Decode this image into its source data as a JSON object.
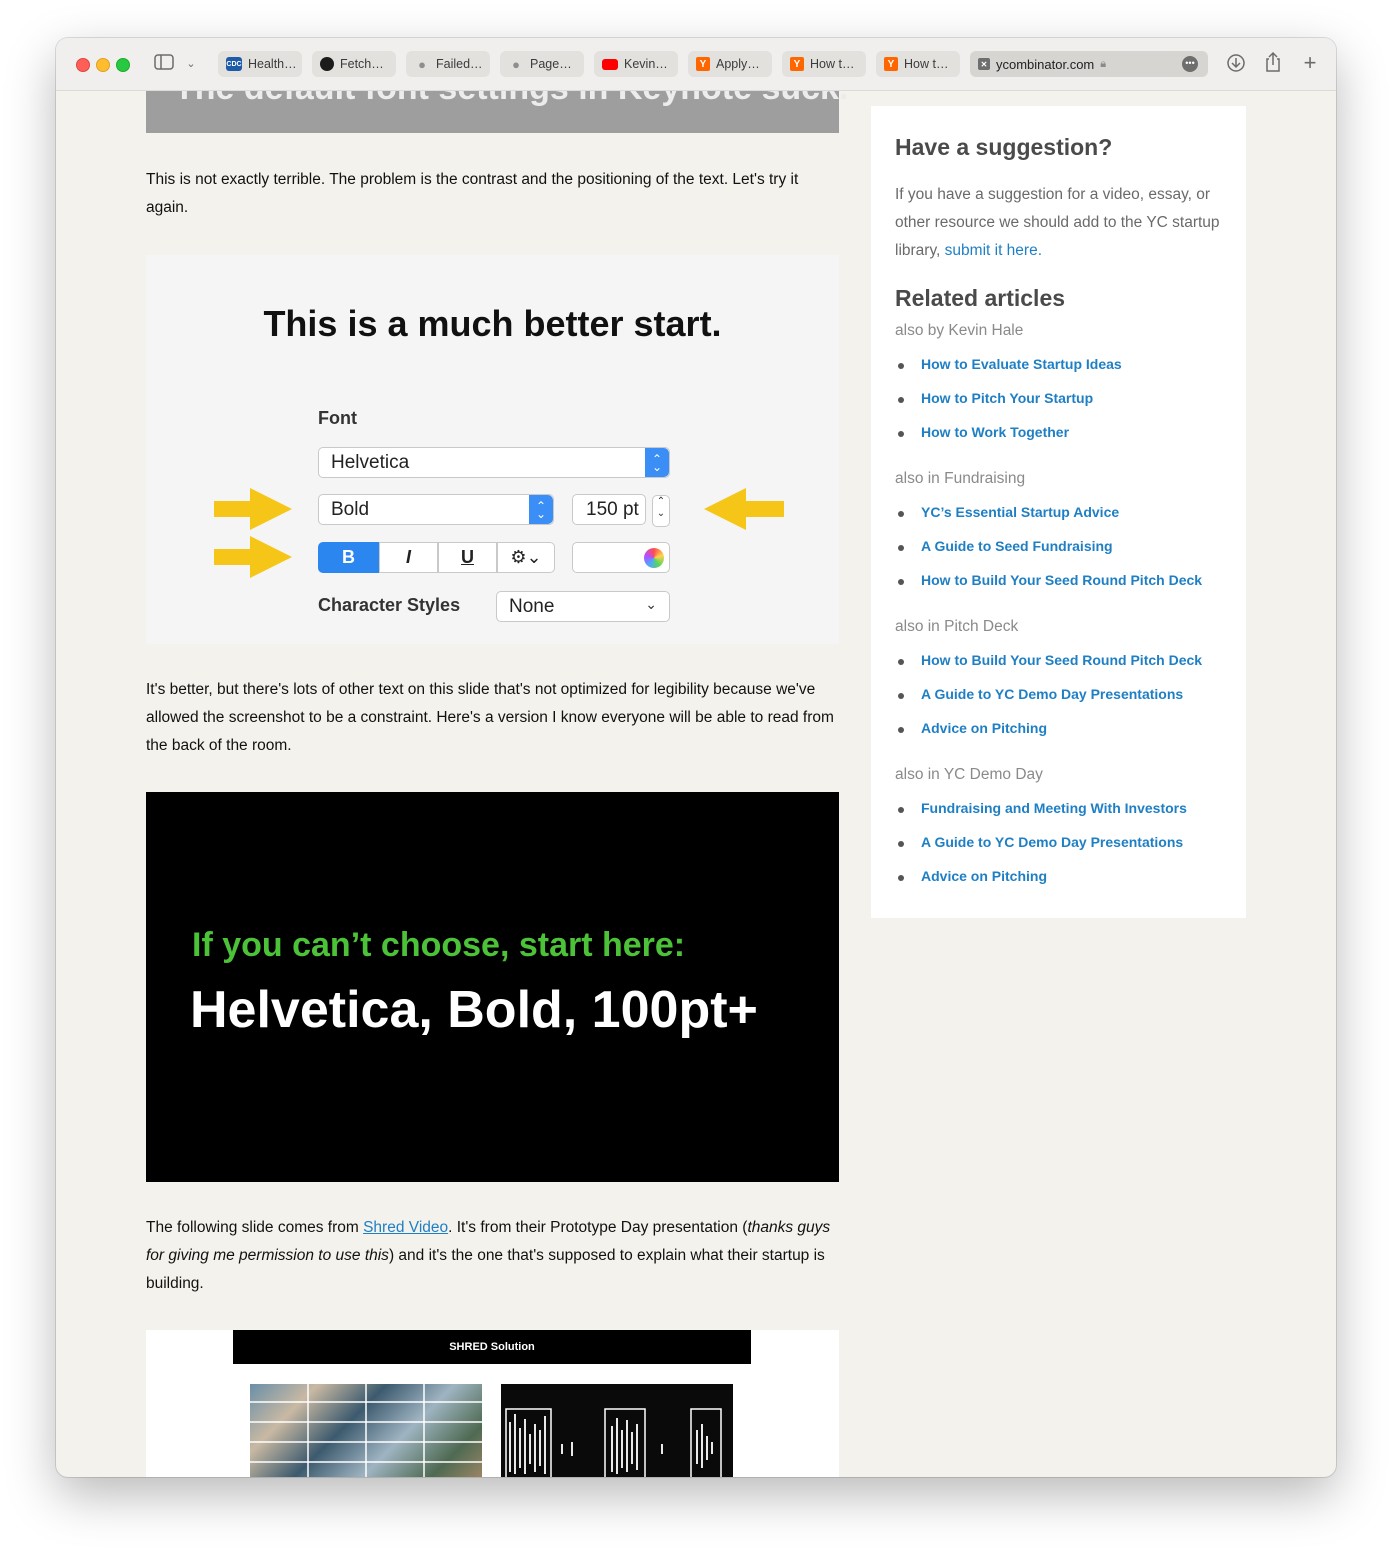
{
  "browser": {
    "tabs": [
      {
        "label": "Health…",
        "favicon": "cdc"
      },
      {
        "label": "Fetch…",
        "favicon": "github"
      },
      {
        "label": "Failed…",
        "favicon": "apple"
      },
      {
        "label": "Page…",
        "favicon": "apple"
      },
      {
        "label": "Kevin…",
        "favicon": "youtube"
      },
      {
        "label": "Apply…",
        "favicon": "ycombinator"
      },
      {
        "label": "How t…",
        "favicon": "ycombinator"
      },
      {
        "label": "How t…",
        "favicon": "ycombinator"
      }
    ],
    "url": "ycombinator.com"
  },
  "article": {
    "banner_text": "The default font settings in Keynote suck.",
    "para1": "This is not exactly terrible. The problem is the contrast and the positioning of the text. Let's try it again.",
    "slide1": {
      "title": "This is a much better start.",
      "font_label": "Font",
      "font_family": "Helvetica",
      "font_style": "Bold",
      "font_size": "150 pt",
      "bold": "B",
      "italic": "I",
      "underline": "U",
      "gear": "⚙⌄",
      "char_styles_label": "Character Styles",
      "char_styles_value": "None"
    },
    "para2": "It's better, but there's lots of other text on this slide that's not optimized for legibility because we've allowed the screenshot to be a constraint. Here's a version I know everyone will be able to read from the back of the room.",
    "slide2": {
      "line1": "If you can’t choose, start here:",
      "line2": "Helvetica, Bold, 100pt+"
    },
    "para3": {
      "before": "The following slide comes from ",
      "link": "Shred Video",
      "middle": ". It's from their Prototype Day presentation (",
      "italic": "thanks guys for giving me permission to use this",
      "after": ") and it's the one that's supposed to explain what their startup is building."
    },
    "slide3": {
      "header": "SHRED Solution"
    }
  },
  "sidebar": {
    "suggestion_title": "Have a suggestion?",
    "suggestion_text": "If you have a suggestion for a video, essay, or other resource we should add to the YC startup library, ",
    "suggestion_link": "submit it here.",
    "related_title": "Related articles",
    "groups": [
      {
        "label": "also by Kevin Hale",
        "links": [
          "How to Evaluate Startup Ideas",
          "How to Pitch Your Startup",
          "How to Work Together"
        ]
      },
      {
        "label": "also in Fundraising",
        "links": [
          "YC’s Essential Startup Advice",
          "A Guide to Seed Fundraising",
          "How to Build Your Seed Round Pitch Deck"
        ]
      },
      {
        "label": "also in Pitch Deck",
        "links": [
          "How to Build Your Seed Round Pitch Deck",
          "A Guide to YC Demo Day Presentations",
          "Advice on Pitching"
        ]
      },
      {
        "label": "also in YC Demo Day",
        "links": [
          "Fundraising and Meeting With Investors",
          "A Guide to YC Demo Day Presentations",
          "Advice on Pitching"
        ]
      }
    ]
  },
  "colors": {
    "link": "#1f7fc4",
    "page_bg": "#f3f2ec",
    "slide_green": "#4cc238",
    "arrow_yellow": "#f5c518"
  }
}
